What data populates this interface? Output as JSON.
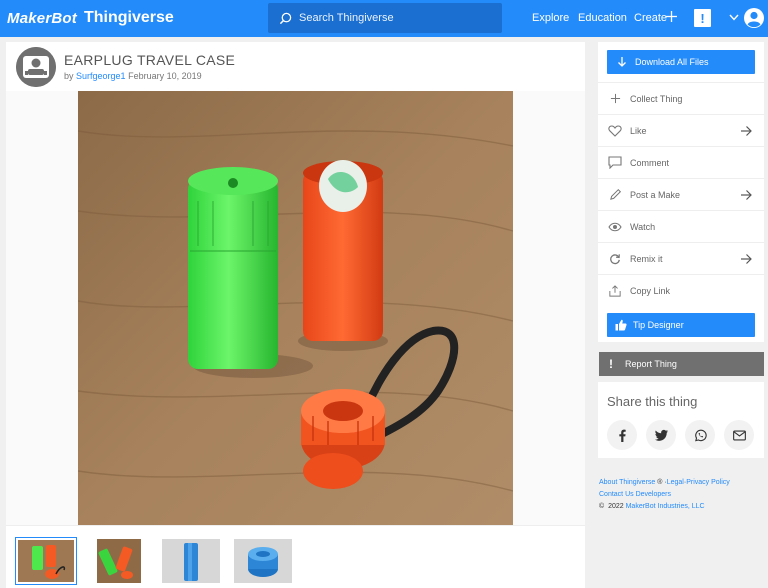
{
  "header": {
    "logo_makerbot": "MakerBot",
    "logo_thingiverse": "Thingiverse",
    "search_placeholder": "Search Thingiverse",
    "nav": {
      "explore": "Explore",
      "education": "Education",
      "create": "Create"
    },
    "alert_label": "!"
  },
  "thing": {
    "title": "EARPLUG TRAVEL CASE",
    "by_prefix": "by",
    "author": "Surfgeorge1",
    "date": "February 10, 2019"
  },
  "gallery": {
    "thumbnails": [
      "photo-cases-cap",
      "photo-cases-tilted",
      "render-blue-tube",
      "render-blue-cap"
    ],
    "selected_index": 0
  },
  "sidebar": {
    "download_label": "Download All Files",
    "actions": [
      {
        "label": "Collect Thing",
        "icon": "plus-icon",
        "arrow": false
      },
      {
        "label": "Like",
        "icon": "heart-icon",
        "arrow": true
      },
      {
        "label": "Comment",
        "icon": "comment-icon",
        "arrow": false
      },
      {
        "label": "Post a Make",
        "icon": "pencil-icon",
        "arrow": true
      },
      {
        "label": "Watch",
        "icon": "eye-icon",
        "arrow": false
      },
      {
        "label": "Remix it",
        "icon": "remix-icon",
        "arrow": true
      },
      {
        "label": "Copy Link",
        "icon": "share-up-icon",
        "arrow": false
      }
    ],
    "tip_label": "Tip Designer",
    "report_label": "Report Thing"
  },
  "share": {
    "title": "Share this thing",
    "networks": [
      "facebook-icon",
      "twitter-icon",
      "whatsapp-icon",
      "email-icon"
    ]
  },
  "footer": {
    "about": "About Thingiverse",
    "registered": "®",
    "sep": "·",
    "legal": "Legal",
    "privacy": "Privacy Policy",
    "contact": "Contact Us",
    "developers": "Developers",
    "copyright_symbol": "©",
    "year": "2022",
    "company": "MakerBot Industries, LLC"
  },
  "colors": {
    "brand_blue": "#248bfb",
    "report_gray": "#707070"
  }
}
